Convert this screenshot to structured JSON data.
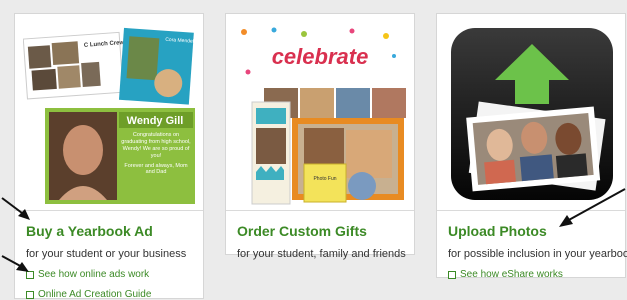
{
  "cards": [
    {
      "title": "Buy a Yearbook Ad",
      "description": "for your student or your business",
      "links": [
        {
          "label": "See how online ads work"
        },
        {
          "label": "Online Ad Creation Guide"
        }
      ],
      "image": {
        "ad_text_1": "C Lunch Crew",
        "ad_text_2": "Cora Mendel",
        "ad_name": "Wendy Gill",
        "ad_message_1": "Congratulations on graduating from high school, Wendy! We are so proud of you!",
        "ad_message_2": "Forever and always, Mom and Dad"
      }
    },
    {
      "title": "Order Custom Gifts",
      "description": "for your student, family and friends",
      "links": [],
      "image": {
        "banner_text": "celebrate",
        "card_text": "Photo Fun"
      }
    },
    {
      "title": "Upload Photos",
      "description": "for possible inclusion in your yearbook",
      "links": [
        {
          "label": "See how eShare works"
        }
      ],
      "image": {}
    }
  ],
  "colors": {
    "accent": "#3c8a26",
    "card_border": "#d6d6d6",
    "page_bg": "#ebebeb"
  }
}
